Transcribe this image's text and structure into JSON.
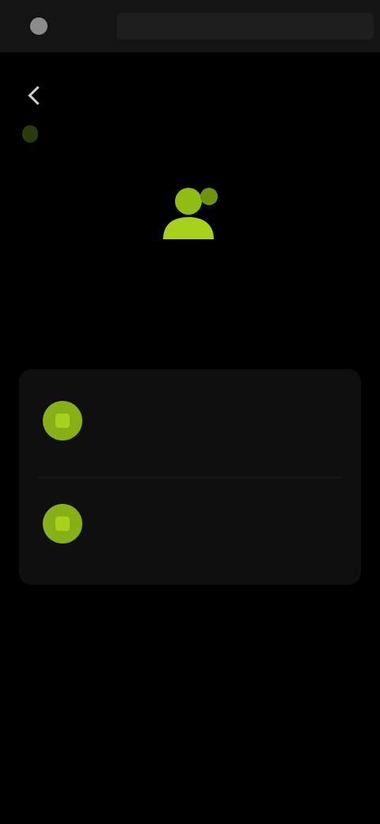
{
  "topbar": {
    "app_name": "",
    "url": ""
  },
  "header": {
    "title": "",
    "filter_label": "",
    "right_link": ""
  },
  "hero": {
    "title": "",
    "description": ""
  },
  "options": [
    {
      "title": "",
      "description": ""
    },
    {
      "title": "",
      "description": ""
    }
  ],
  "colors": {
    "accent": "#a7d11d",
    "background": "#000000",
    "card": "#0f0f0f"
  }
}
